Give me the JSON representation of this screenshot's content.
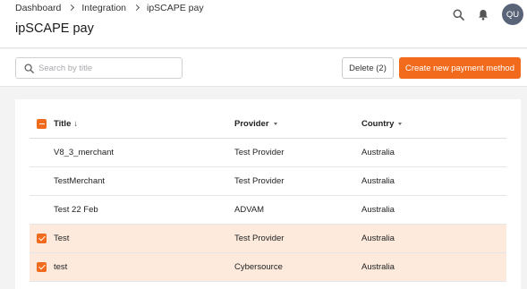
{
  "breadcrumb": {
    "items": [
      "Dashboard",
      "Integration",
      "ipSCAPE pay"
    ]
  },
  "page_title": "ipSCAPE pay",
  "header": {
    "icons": [
      "search-icon",
      "bell-icon"
    ],
    "avatar_initials": "QU"
  },
  "toolbar": {
    "search_placeholder": "Search by title",
    "search_value": "",
    "delete_label": "Delete (2)",
    "create_label": "Create new payment method"
  },
  "table": {
    "columns": {
      "title": "Title",
      "title_sort": "↓",
      "provider": "Provider",
      "country": "Country"
    },
    "header_checkbox": "indeterminate",
    "rows": [
      {
        "title": "V8_3_merchant",
        "provider": "Test Provider",
        "country": "Australia",
        "selected": false
      },
      {
        "title": "TestMerchant",
        "provider": "Test Provider",
        "country": "Australia",
        "selected": false
      },
      {
        "title": "Test 22 Feb",
        "provider": "ADVAM",
        "country": "Australia",
        "selected": false
      },
      {
        "title": "Test",
        "provider": "Test Provider",
        "country": "Australia",
        "selected": true
      },
      {
        "title": "test",
        "provider": "Cybersource",
        "country": "Australia",
        "selected": true
      }
    ]
  },
  "colors": {
    "accent": "#f26b1d",
    "selected_row": "#fdeadd",
    "avatar": "#5a6478"
  }
}
